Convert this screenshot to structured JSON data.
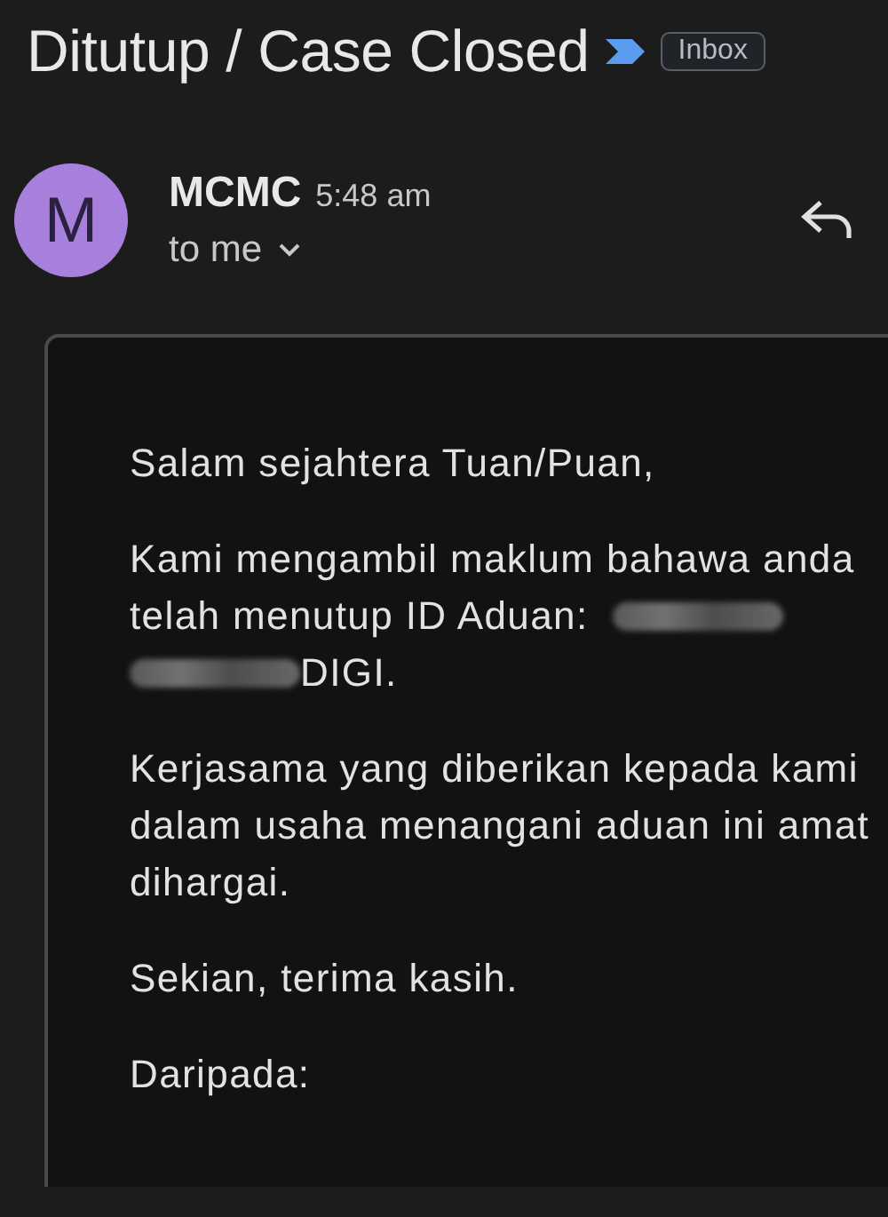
{
  "subject": {
    "title": "Ditutup / Case Closed",
    "label": "Inbox",
    "important": true
  },
  "message": {
    "avatar_letter": "M",
    "color": "#a77fdc",
    "sender": "MCMC",
    "time": "5:48 am",
    "recipient": "to me"
  },
  "body": [
    {
      "kind": "text",
      "text": "Salam sejahtera Tuan/Puan,"
    },
    {
      "kind": "redacted",
      "lines": [
        "Kami mengambil maklum bahawa anda",
        "telah menutup ID Aduan:"
      ],
      "after": "DIGI."
    },
    {
      "kind": "text",
      "text": "Kerjasama yang diberikan kepada kami dalam usaha menangani aduan ini amat dihargai."
    },
    {
      "kind": "text",
      "text": "Sekian, terima kasih."
    },
    {
      "kind": "text",
      "text": "Daripada:"
    }
  ]
}
